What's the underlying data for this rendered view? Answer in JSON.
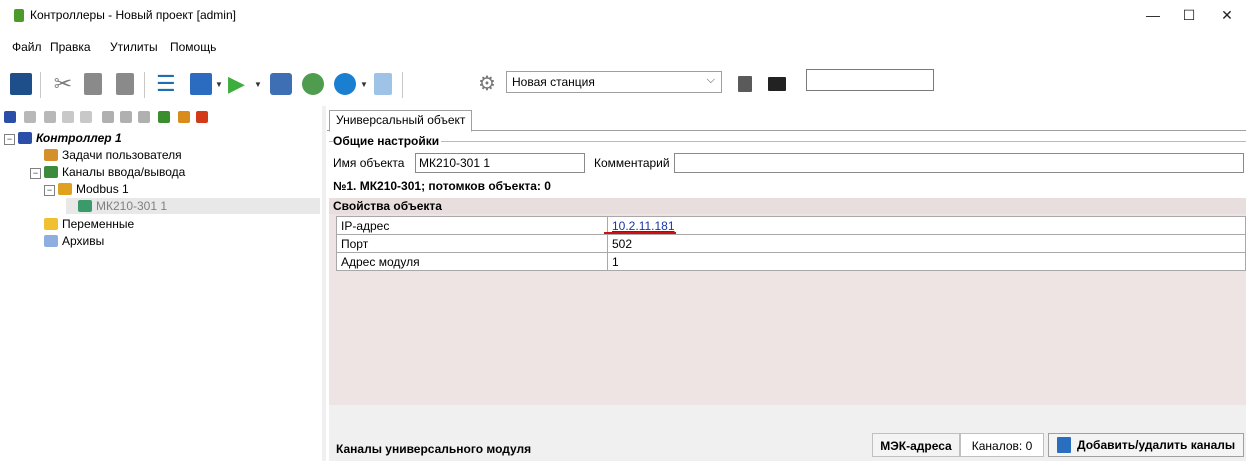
{
  "window": {
    "title": "Контроллеры - Новый проект [admin]",
    "controls": {
      "minimize": "—",
      "maximize": "☐",
      "close": "✕"
    }
  },
  "menu": [
    "Файл",
    "Правка",
    "Утилиты",
    "Помощь"
  ],
  "toolbar": {
    "station_select_value": "Новая станция",
    "search_value": ""
  },
  "tree": {
    "items": [
      {
        "label": "Контроллер 1",
        "level": 0
      },
      {
        "label": "Задачи пользователя",
        "level": 1
      },
      {
        "label": "Каналы ввода/вывода",
        "level": 1
      },
      {
        "label": "Modbus 1",
        "level": 2
      },
      {
        "label": "МК210-301 1",
        "level": 3
      },
      {
        "label": "Переменные",
        "level": 1
      },
      {
        "label": "Архивы",
        "level": 1
      }
    ]
  },
  "tabs": {
    "active": "Универсальный объект"
  },
  "general": {
    "group_title": "Общие настройки",
    "name_label": "Имя объекта",
    "name_value": "МК210-301 1",
    "comment_label": "Комментарий",
    "comment_value": "",
    "info": "№1. МК210-301; потомков объекта: 0"
  },
  "properties": {
    "title": "Свойства объекта",
    "rows": [
      {
        "key": "IP-адрес",
        "value": "10.2.11.181"
      },
      {
        "key": "Порт",
        "value": "502"
      },
      {
        "key": "Адрес модуля",
        "value": "1"
      }
    ]
  },
  "bottom": {
    "title": "Каналы универсального модуля",
    "mek_tab": "МЭК-адреса",
    "channels_count": "Каналов: 0",
    "add_button": "Добавить/удалить каналы"
  },
  "colors": {
    "accent_underline": "#d01010",
    "props_bg": "#efe4e4",
    "link": "#1b36a3"
  }
}
